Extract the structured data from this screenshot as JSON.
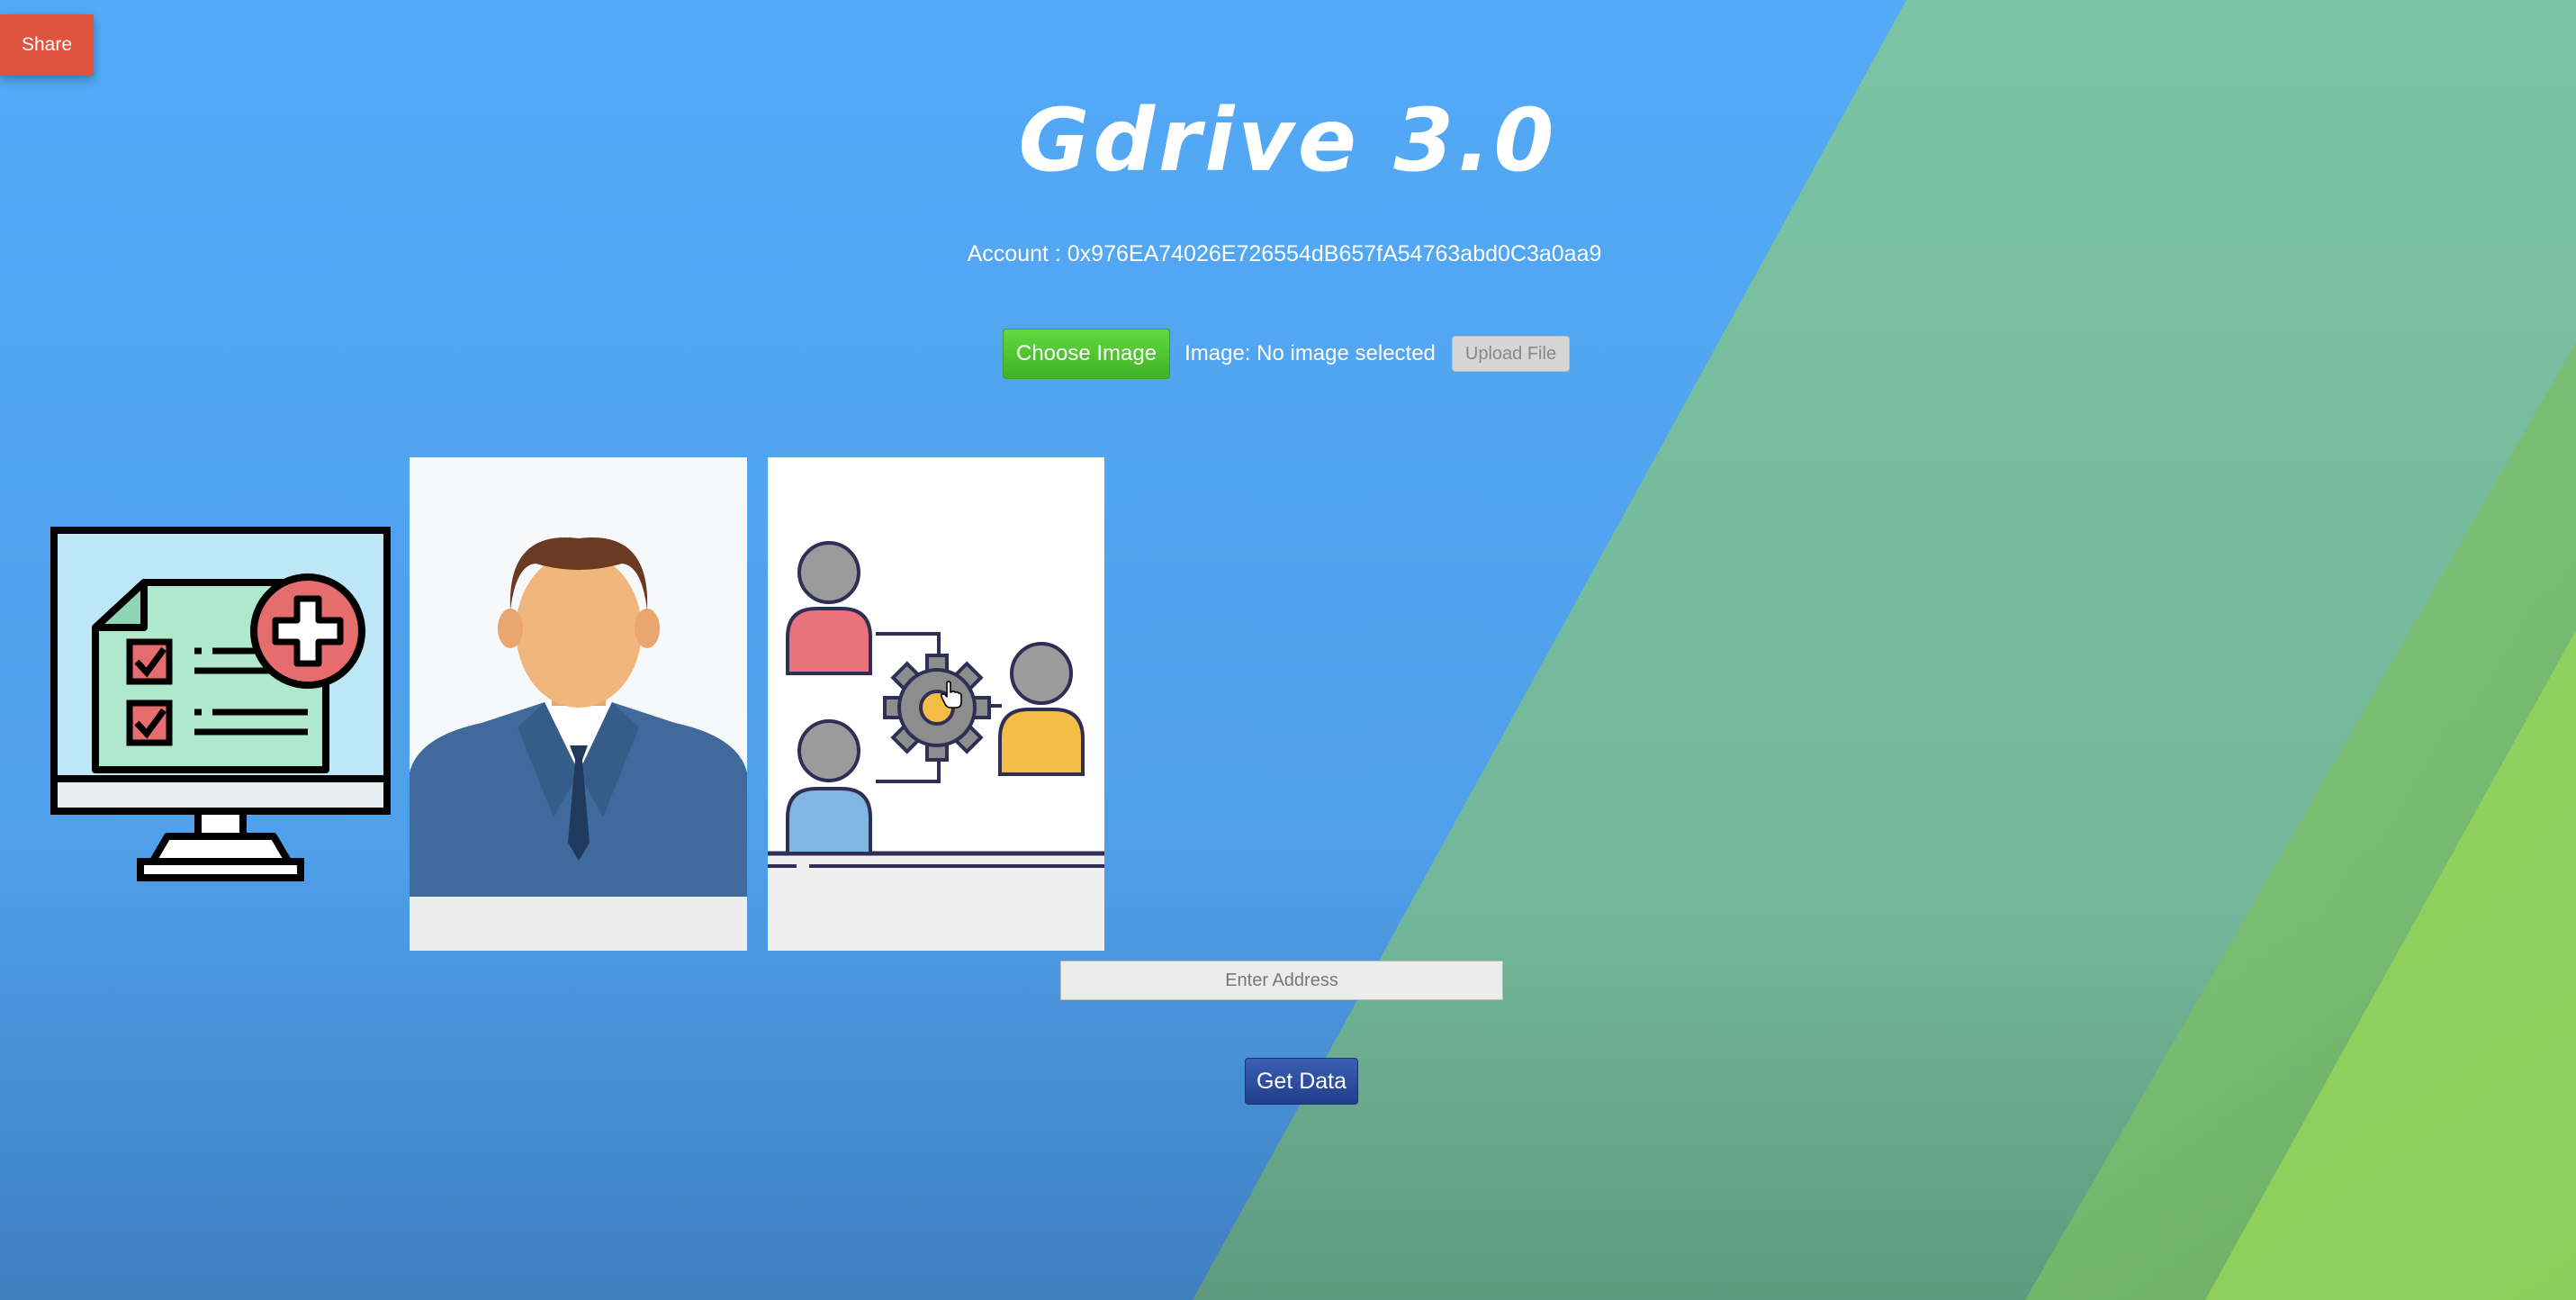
{
  "share_label": "Share",
  "app_title": "Gdrive 3.0",
  "account_label": "Account : 0x976EA74026E726554dB657fA54763abd0C3a0aa9",
  "upload": {
    "choose_label": "Choose Image",
    "status_text": "Image: No image selected",
    "upload_label": "Upload File"
  },
  "address_input": {
    "placeholder": "Enter Address",
    "value": ""
  },
  "get_data_label": "Get Data",
  "colors": {
    "background_blue": "#53a9f5",
    "background_teal": "#79c2a2",
    "share_red": "#e0533f",
    "choose_green": "#4fc92f",
    "get_data_blue": "#2c4c9e"
  },
  "icons": {
    "gallery": [
      "monitor-checklist-icon",
      "businessman-avatar-icon",
      "team-workflow-icon"
    ],
    "pointer": "hand-cursor-icon"
  }
}
